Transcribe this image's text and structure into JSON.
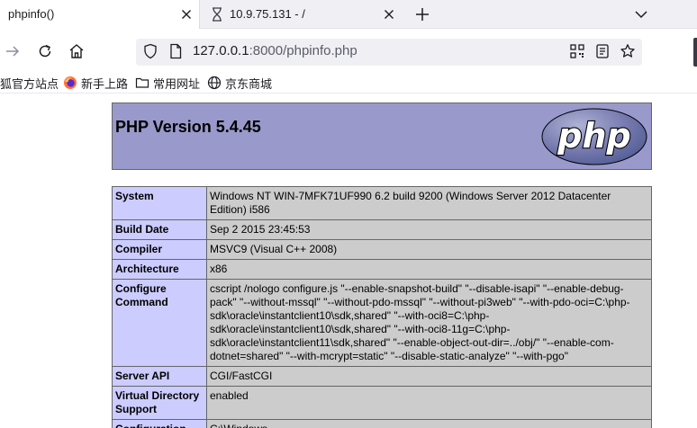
{
  "tabs": [
    {
      "title": "phpinfo()",
      "active": true
    },
    {
      "title": "10.9.75.131 - /",
      "active": false
    }
  ],
  "address": {
    "host": "127.0.0.1",
    "rest": ":8000/phpinfo.php"
  },
  "bookmarks": [
    {
      "label": "狐官方站点",
      "icon": "none"
    },
    {
      "label": "新手上路",
      "icon": "firefox-icon"
    },
    {
      "label": "常用网址",
      "icon": "folder-icon"
    },
    {
      "label": "京东商城",
      "icon": "globe-icon"
    }
  ],
  "php": {
    "version_title": "PHP Version 5.4.45",
    "logo_text": "php"
  },
  "info_rows": [
    {
      "key": "System",
      "value": "Windows NT WIN-7MFK71UF990 6.2 build 9200 (Windows Server 2012 Datacenter Edition) i586"
    },
    {
      "key": "Build Date",
      "value": "Sep 2 2015 23:45:53"
    },
    {
      "key": "Compiler",
      "value": "MSVC9 (Visual C++ 2008)"
    },
    {
      "key": "Architecture",
      "value": "x86"
    },
    {
      "key": "Configure Command",
      "value": "cscript /nologo configure.js \"--enable-snapshot-build\" \"--disable-isapi\" \"--enable-debug-pack\" \"--without-mssql\" \"--without-pdo-mssql\" \"--without-pi3web\" \"--with-pdo-oci=C:\\php-sdk\\oracle\\instantclient10\\sdk,shared\" \"--with-oci8=C:\\php-sdk\\oracle\\instantclient10\\sdk,shared\" \"--with-oci8-11g=C:\\php-sdk\\oracle\\instantclient11\\sdk,shared\" \"--enable-object-out-dir=../obj/\" \"--enable-com-dotnet=shared\" \"--with-mcrypt=static\" \"--disable-static-analyze\" \"--with-pgo\""
    },
    {
      "key": "Server API",
      "value": "CGI/FastCGI"
    },
    {
      "key": "Virtual Directory Support",
      "value": "enabled"
    },
    {
      "key": "Configuration",
      "value": "C:\\Windows"
    }
  ]
}
